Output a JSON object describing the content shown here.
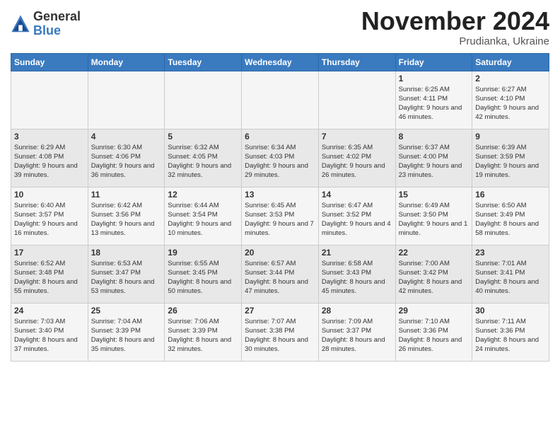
{
  "logo": {
    "general": "General",
    "blue": "Blue"
  },
  "title": "November 2024",
  "subtitle": "Prudianka, Ukraine",
  "headers": [
    "Sunday",
    "Monday",
    "Tuesday",
    "Wednesday",
    "Thursday",
    "Friday",
    "Saturday"
  ],
  "weeks": [
    [
      {
        "day": "",
        "info": ""
      },
      {
        "day": "",
        "info": ""
      },
      {
        "day": "",
        "info": ""
      },
      {
        "day": "",
        "info": ""
      },
      {
        "day": "",
        "info": ""
      },
      {
        "day": "1",
        "info": "Sunrise: 6:25 AM\nSunset: 4:11 PM\nDaylight: 9 hours and 46 minutes."
      },
      {
        "day": "2",
        "info": "Sunrise: 6:27 AM\nSunset: 4:10 PM\nDaylight: 9 hours and 42 minutes."
      }
    ],
    [
      {
        "day": "3",
        "info": "Sunrise: 6:29 AM\nSunset: 4:08 PM\nDaylight: 9 hours and 39 minutes."
      },
      {
        "day": "4",
        "info": "Sunrise: 6:30 AM\nSunset: 4:06 PM\nDaylight: 9 hours and 36 minutes."
      },
      {
        "day": "5",
        "info": "Sunrise: 6:32 AM\nSunset: 4:05 PM\nDaylight: 9 hours and 32 minutes."
      },
      {
        "day": "6",
        "info": "Sunrise: 6:34 AM\nSunset: 4:03 PM\nDaylight: 9 hours and 29 minutes."
      },
      {
        "day": "7",
        "info": "Sunrise: 6:35 AM\nSunset: 4:02 PM\nDaylight: 9 hours and 26 minutes."
      },
      {
        "day": "8",
        "info": "Sunrise: 6:37 AM\nSunset: 4:00 PM\nDaylight: 9 hours and 23 minutes."
      },
      {
        "day": "9",
        "info": "Sunrise: 6:39 AM\nSunset: 3:59 PM\nDaylight: 9 hours and 19 minutes."
      }
    ],
    [
      {
        "day": "10",
        "info": "Sunrise: 6:40 AM\nSunset: 3:57 PM\nDaylight: 9 hours and 16 minutes."
      },
      {
        "day": "11",
        "info": "Sunrise: 6:42 AM\nSunset: 3:56 PM\nDaylight: 9 hours and 13 minutes."
      },
      {
        "day": "12",
        "info": "Sunrise: 6:44 AM\nSunset: 3:54 PM\nDaylight: 9 hours and 10 minutes."
      },
      {
        "day": "13",
        "info": "Sunrise: 6:45 AM\nSunset: 3:53 PM\nDaylight: 9 hours and 7 minutes."
      },
      {
        "day": "14",
        "info": "Sunrise: 6:47 AM\nSunset: 3:52 PM\nDaylight: 9 hours and 4 minutes."
      },
      {
        "day": "15",
        "info": "Sunrise: 6:49 AM\nSunset: 3:50 PM\nDaylight: 9 hours and 1 minute."
      },
      {
        "day": "16",
        "info": "Sunrise: 6:50 AM\nSunset: 3:49 PM\nDaylight: 8 hours and 58 minutes."
      }
    ],
    [
      {
        "day": "17",
        "info": "Sunrise: 6:52 AM\nSunset: 3:48 PM\nDaylight: 8 hours and 55 minutes."
      },
      {
        "day": "18",
        "info": "Sunrise: 6:53 AM\nSunset: 3:47 PM\nDaylight: 8 hours and 53 minutes."
      },
      {
        "day": "19",
        "info": "Sunrise: 6:55 AM\nSunset: 3:45 PM\nDaylight: 8 hours and 50 minutes."
      },
      {
        "day": "20",
        "info": "Sunrise: 6:57 AM\nSunset: 3:44 PM\nDaylight: 8 hours and 47 minutes."
      },
      {
        "day": "21",
        "info": "Sunrise: 6:58 AM\nSunset: 3:43 PM\nDaylight: 8 hours and 45 minutes."
      },
      {
        "day": "22",
        "info": "Sunrise: 7:00 AM\nSunset: 3:42 PM\nDaylight: 8 hours and 42 minutes."
      },
      {
        "day": "23",
        "info": "Sunrise: 7:01 AM\nSunset: 3:41 PM\nDaylight: 8 hours and 40 minutes."
      }
    ],
    [
      {
        "day": "24",
        "info": "Sunrise: 7:03 AM\nSunset: 3:40 PM\nDaylight: 8 hours and 37 minutes."
      },
      {
        "day": "25",
        "info": "Sunrise: 7:04 AM\nSunset: 3:39 PM\nDaylight: 8 hours and 35 minutes."
      },
      {
        "day": "26",
        "info": "Sunrise: 7:06 AM\nSunset: 3:39 PM\nDaylight: 8 hours and 32 minutes."
      },
      {
        "day": "27",
        "info": "Sunrise: 7:07 AM\nSunset: 3:38 PM\nDaylight: 8 hours and 30 minutes."
      },
      {
        "day": "28",
        "info": "Sunrise: 7:09 AM\nSunset: 3:37 PM\nDaylight: 8 hours and 28 minutes."
      },
      {
        "day": "29",
        "info": "Sunrise: 7:10 AM\nSunset: 3:36 PM\nDaylight: 8 hours and 26 minutes."
      },
      {
        "day": "30",
        "info": "Sunrise: 7:11 AM\nSunset: 3:36 PM\nDaylight: 8 hours and 24 minutes."
      }
    ]
  ]
}
